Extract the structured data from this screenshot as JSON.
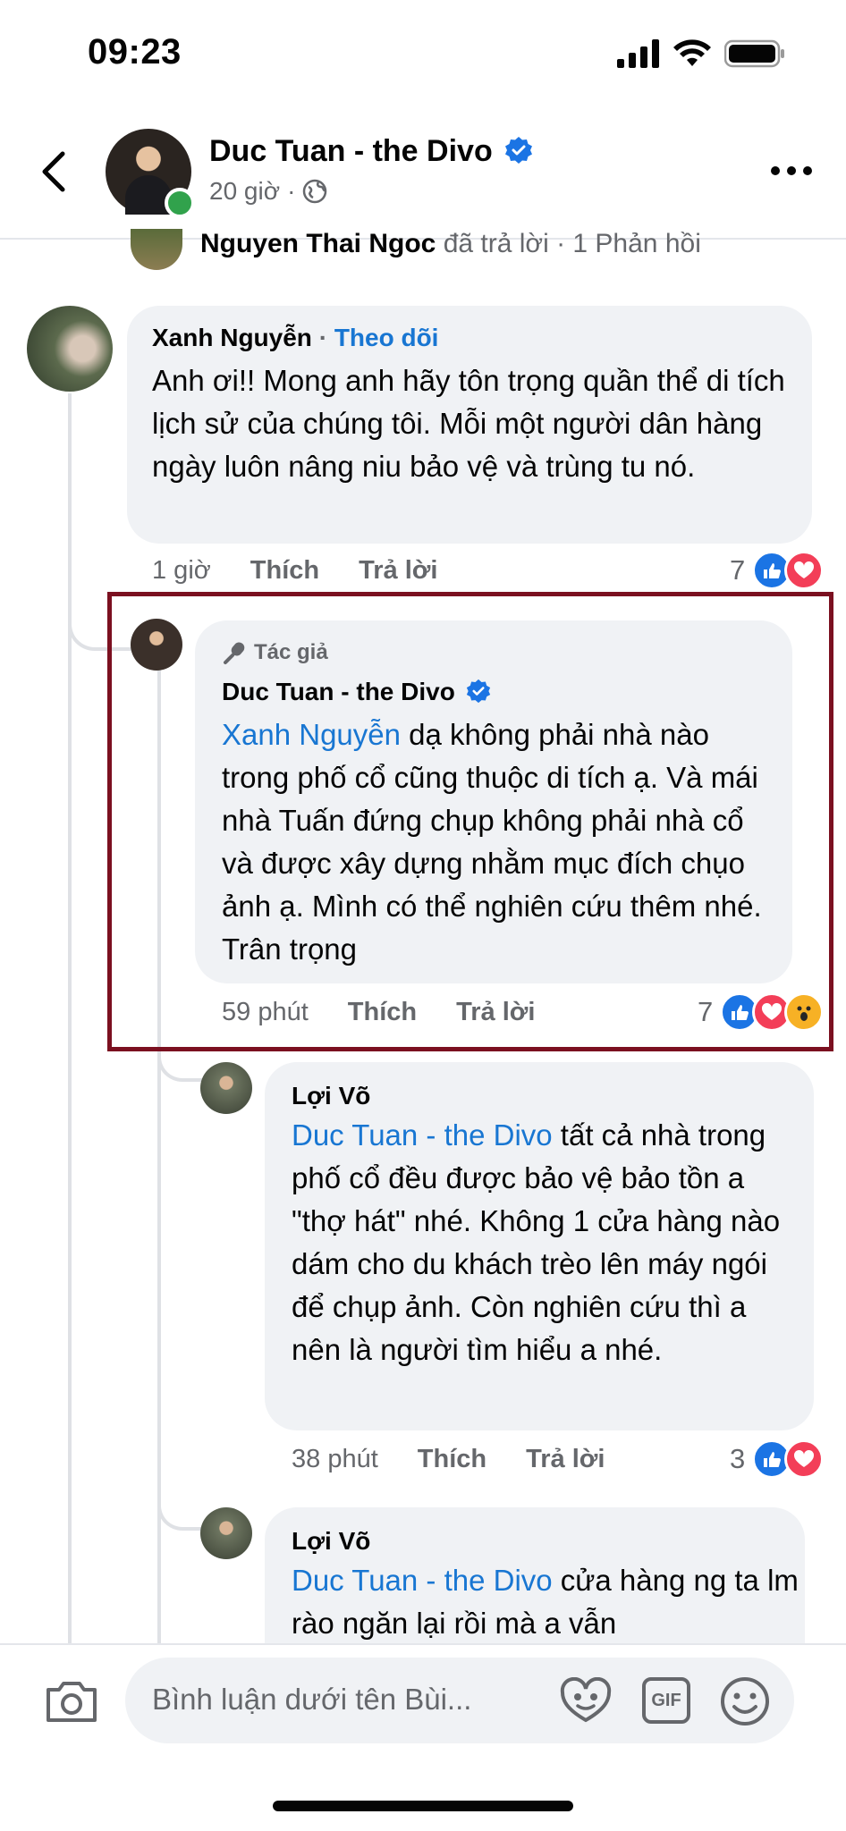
{
  "status_bar": {
    "time": "09:23"
  },
  "header": {
    "name": "Duc Tuan - the Divo",
    "time": "20 giờ",
    "separator": "·"
  },
  "partial_row": {
    "name": "Nguyen Thai Ngoc",
    "text": " đã trả lời · 1 Phản hồi"
  },
  "comments": [
    {
      "author": "Xanh Nguyễn",
      "follow_label": "Theo dõi",
      "separator": "·",
      "text": "Anh ơi!! Mong anh hãy tôn trọng quần thể di tích lịch sử của chúng tôi. Mỗi một người dân hàng ngày luôn nâng niu bảo vệ và trùng tu nó.",
      "time": "1 giờ",
      "like_label": "Thích",
      "reply_label": "Trả lời",
      "reaction_count": "7"
    },
    {
      "badge": "Tác giả",
      "author": "Duc Tuan - the Divo",
      "mention": "Xanh Nguyễn",
      "text": " dạ không phải nhà nào trong phố cổ cũng thuộc di tích ạ. Và mái nhà Tuấn đứng chụp không phải nhà cổ và được xây dựng nhằm mục đích chụo ảnh ạ. Mình có thể nghiên cứu thêm nhé. Trân trọng",
      "time": "59 phút",
      "like_label": "Thích",
      "reply_label": "Trả lời",
      "reaction_count": "7"
    },
    {
      "author": "Lợi Võ",
      "mention": "Duc Tuan - the Divo",
      "text": " tất cả nhà trong phố cổ đều được bảo vệ bảo tồn a \"thợ hát\" nhé. Không 1 cửa hàng nào dám cho du khách trèo lên máy ngói để chụp ảnh. Còn nghiên cứu thì a nên là người tìm hiểu a nhé.",
      "time": "38 phút",
      "like_label": "Thích",
      "reply_label": "Trả lời",
      "reaction_count": "3"
    },
    {
      "author": "Lợi Võ",
      "mention": "Duc Tuan - the Divo",
      "text": " cửa hàng ng ta lm rào ngăn lại rồi mà a vẫn"
    }
  ],
  "composer": {
    "placeholder": "Bình luận dưới tên Bùi...",
    "gif_label": "GIF"
  },
  "colors": {
    "accent": "#1876d2",
    "highlight_border": "#7b1020",
    "bubble": "#f0f2f5"
  }
}
